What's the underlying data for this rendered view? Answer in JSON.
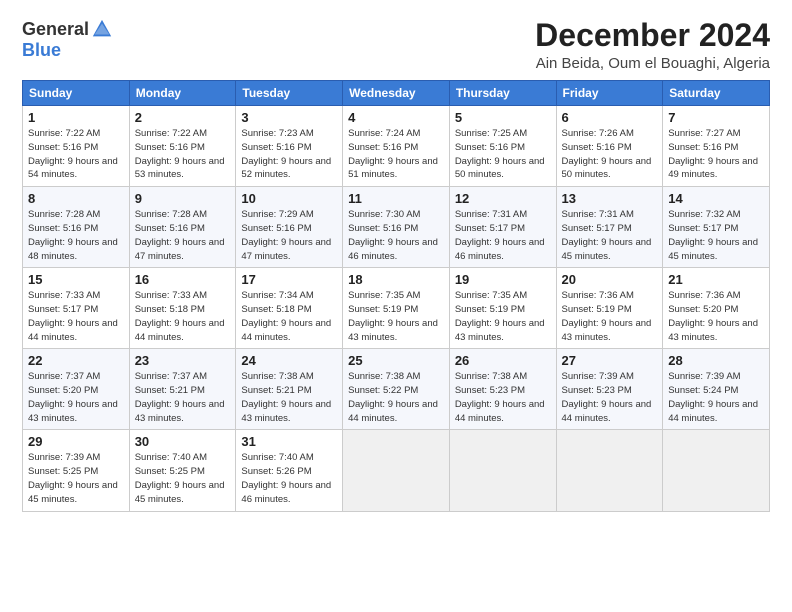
{
  "logo": {
    "general": "General",
    "blue": "Blue"
  },
  "header": {
    "title": "December 2024",
    "subtitle": "Ain Beida, Oum el Bouaghi, Algeria"
  },
  "weekdays": [
    "Sunday",
    "Monday",
    "Tuesday",
    "Wednesday",
    "Thursday",
    "Friday",
    "Saturday"
  ],
  "weeks": [
    [
      {
        "day": 1,
        "sunrise": "7:22 AM",
        "sunset": "5:16 PM",
        "daylight": "9 hours and 54 minutes."
      },
      {
        "day": 2,
        "sunrise": "7:22 AM",
        "sunset": "5:16 PM",
        "daylight": "9 hours and 53 minutes."
      },
      {
        "day": 3,
        "sunrise": "7:23 AM",
        "sunset": "5:16 PM",
        "daylight": "9 hours and 52 minutes."
      },
      {
        "day": 4,
        "sunrise": "7:24 AM",
        "sunset": "5:16 PM",
        "daylight": "9 hours and 51 minutes."
      },
      {
        "day": 5,
        "sunrise": "7:25 AM",
        "sunset": "5:16 PM",
        "daylight": "9 hours and 50 minutes."
      },
      {
        "day": 6,
        "sunrise": "7:26 AM",
        "sunset": "5:16 PM",
        "daylight": "9 hours and 50 minutes."
      },
      {
        "day": 7,
        "sunrise": "7:27 AM",
        "sunset": "5:16 PM",
        "daylight": "9 hours and 49 minutes."
      }
    ],
    [
      {
        "day": 8,
        "sunrise": "7:28 AM",
        "sunset": "5:16 PM",
        "daylight": "9 hours and 48 minutes."
      },
      {
        "day": 9,
        "sunrise": "7:28 AM",
        "sunset": "5:16 PM",
        "daylight": "9 hours and 47 minutes."
      },
      {
        "day": 10,
        "sunrise": "7:29 AM",
        "sunset": "5:16 PM",
        "daylight": "9 hours and 47 minutes."
      },
      {
        "day": 11,
        "sunrise": "7:30 AM",
        "sunset": "5:16 PM",
        "daylight": "9 hours and 46 minutes."
      },
      {
        "day": 12,
        "sunrise": "7:31 AM",
        "sunset": "5:17 PM",
        "daylight": "9 hours and 46 minutes."
      },
      {
        "day": 13,
        "sunrise": "7:31 AM",
        "sunset": "5:17 PM",
        "daylight": "9 hours and 45 minutes."
      },
      {
        "day": 14,
        "sunrise": "7:32 AM",
        "sunset": "5:17 PM",
        "daylight": "9 hours and 45 minutes."
      }
    ],
    [
      {
        "day": 15,
        "sunrise": "7:33 AM",
        "sunset": "5:17 PM",
        "daylight": "9 hours and 44 minutes."
      },
      {
        "day": 16,
        "sunrise": "7:33 AM",
        "sunset": "5:18 PM",
        "daylight": "9 hours and 44 minutes."
      },
      {
        "day": 17,
        "sunrise": "7:34 AM",
        "sunset": "5:18 PM",
        "daylight": "9 hours and 44 minutes."
      },
      {
        "day": 18,
        "sunrise": "7:35 AM",
        "sunset": "5:19 PM",
        "daylight": "9 hours and 43 minutes."
      },
      {
        "day": 19,
        "sunrise": "7:35 AM",
        "sunset": "5:19 PM",
        "daylight": "9 hours and 43 minutes."
      },
      {
        "day": 20,
        "sunrise": "7:36 AM",
        "sunset": "5:19 PM",
        "daylight": "9 hours and 43 minutes."
      },
      {
        "day": 21,
        "sunrise": "7:36 AM",
        "sunset": "5:20 PM",
        "daylight": "9 hours and 43 minutes."
      }
    ],
    [
      {
        "day": 22,
        "sunrise": "7:37 AM",
        "sunset": "5:20 PM",
        "daylight": "9 hours and 43 minutes."
      },
      {
        "day": 23,
        "sunrise": "7:37 AM",
        "sunset": "5:21 PM",
        "daylight": "9 hours and 43 minutes."
      },
      {
        "day": 24,
        "sunrise": "7:38 AM",
        "sunset": "5:21 PM",
        "daylight": "9 hours and 43 minutes."
      },
      {
        "day": 25,
        "sunrise": "7:38 AM",
        "sunset": "5:22 PM",
        "daylight": "9 hours and 44 minutes."
      },
      {
        "day": 26,
        "sunrise": "7:38 AM",
        "sunset": "5:23 PM",
        "daylight": "9 hours and 44 minutes."
      },
      {
        "day": 27,
        "sunrise": "7:39 AM",
        "sunset": "5:23 PM",
        "daylight": "9 hours and 44 minutes."
      },
      {
        "day": 28,
        "sunrise": "7:39 AM",
        "sunset": "5:24 PM",
        "daylight": "9 hours and 44 minutes."
      }
    ],
    [
      {
        "day": 29,
        "sunrise": "7:39 AM",
        "sunset": "5:25 PM",
        "daylight": "9 hours and 45 minutes."
      },
      {
        "day": 30,
        "sunrise": "7:40 AM",
        "sunset": "5:25 PM",
        "daylight": "9 hours and 45 minutes."
      },
      {
        "day": 31,
        "sunrise": "7:40 AM",
        "sunset": "5:26 PM",
        "daylight": "9 hours and 46 minutes."
      },
      null,
      null,
      null,
      null
    ]
  ]
}
